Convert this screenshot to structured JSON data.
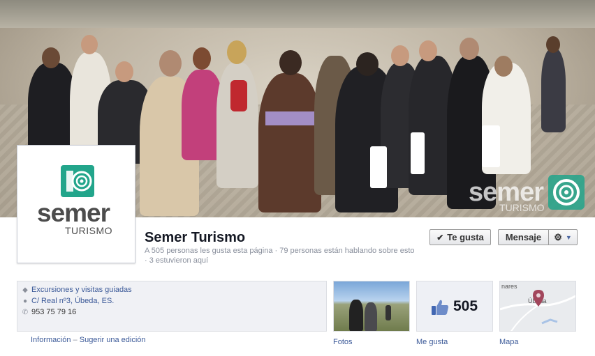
{
  "cover": {
    "brand_word": "semer",
    "brand_sub": "TURISMO"
  },
  "profile": {
    "logo_word": "semer",
    "logo_sub": "TURISMO"
  },
  "page": {
    "name": "Semer Turismo",
    "stats": "A 505 personas les gusta esta página · 79 personas están hablando sobre esto · 3 estuvieron aquí"
  },
  "actions": {
    "like_label": "Te gusta",
    "message_label": "Mensaje"
  },
  "info": {
    "category": "Excursiones y visitas guiadas",
    "address": "C/ Real nº3, Úbeda, ES.",
    "phone": "953 75 79 16",
    "links": [
      "Información",
      "–",
      "Sugerir una edición"
    ]
  },
  "tiles": {
    "photos_label": "Fotos",
    "likes_count": "505",
    "likes_label": "Me gusta",
    "map_label": "Mapa",
    "map_text_top": "nares",
    "map_text_city": "Úbeda"
  },
  "colors": {
    "link": "#3b5998",
    "brand_green": "#22a58b",
    "like_blue": "#4267b2"
  }
}
